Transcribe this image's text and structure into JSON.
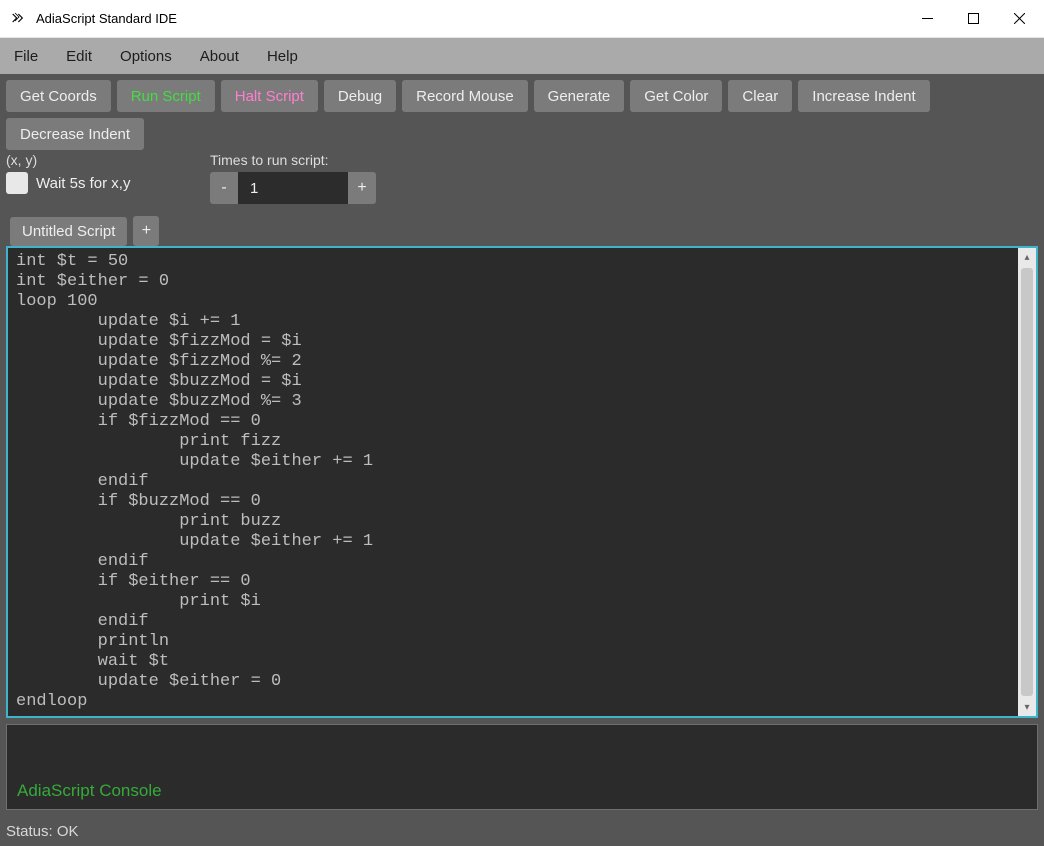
{
  "window": {
    "title": "AdiaScript Standard IDE"
  },
  "menu": {
    "items": [
      "File",
      "Edit",
      "Options",
      "About",
      "Help"
    ]
  },
  "toolbar": {
    "buttons": [
      {
        "label": "Get Coords",
        "cls": ""
      },
      {
        "label": "Run Script",
        "cls": "run"
      },
      {
        "label": "Halt Script",
        "cls": "halt"
      },
      {
        "label": "Debug",
        "cls": ""
      },
      {
        "label": "Record Mouse",
        "cls": ""
      },
      {
        "label": "Generate",
        "cls": ""
      },
      {
        "label": "Get Color",
        "cls": ""
      },
      {
        "label": "Clear",
        "cls": ""
      },
      {
        "label": "Increase Indent",
        "cls": ""
      },
      {
        "label": "Decrease Indent",
        "cls": ""
      }
    ]
  },
  "coords": {
    "text": "(x, y)",
    "wait_label": "Wait 5s for x,y"
  },
  "times": {
    "label": "Times to run script:",
    "value": "1"
  },
  "tabs": {
    "items": [
      "Untitled Script"
    ],
    "add": "+"
  },
  "editor": {
    "lines": [
      "int $t = 50",
      "int $either = 0",
      "loop 100",
      "        update $i += 1",
      "        update $fizzMod = $i",
      "        update $fizzMod %= 2",
      "        update $buzzMod = $i",
      "        update $buzzMod %= 3",
      "        if $fizzMod == 0",
      "                print fizz",
      "                update $either += 1",
      "        endif",
      "        if $buzzMod == 0",
      "                print buzz",
      "                update $either += 1",
      "        endif",
      "        if $either == 0",
      "                print $i",
      "        endif",
      "        println",
      "        wait $t",
      "        update $either = 0",
      "endloop"
    ]
  },
  "console": {
    "text": "AdiaScript Console"
  },
  "status": {
    "text": "Status: OK"
  }
}
